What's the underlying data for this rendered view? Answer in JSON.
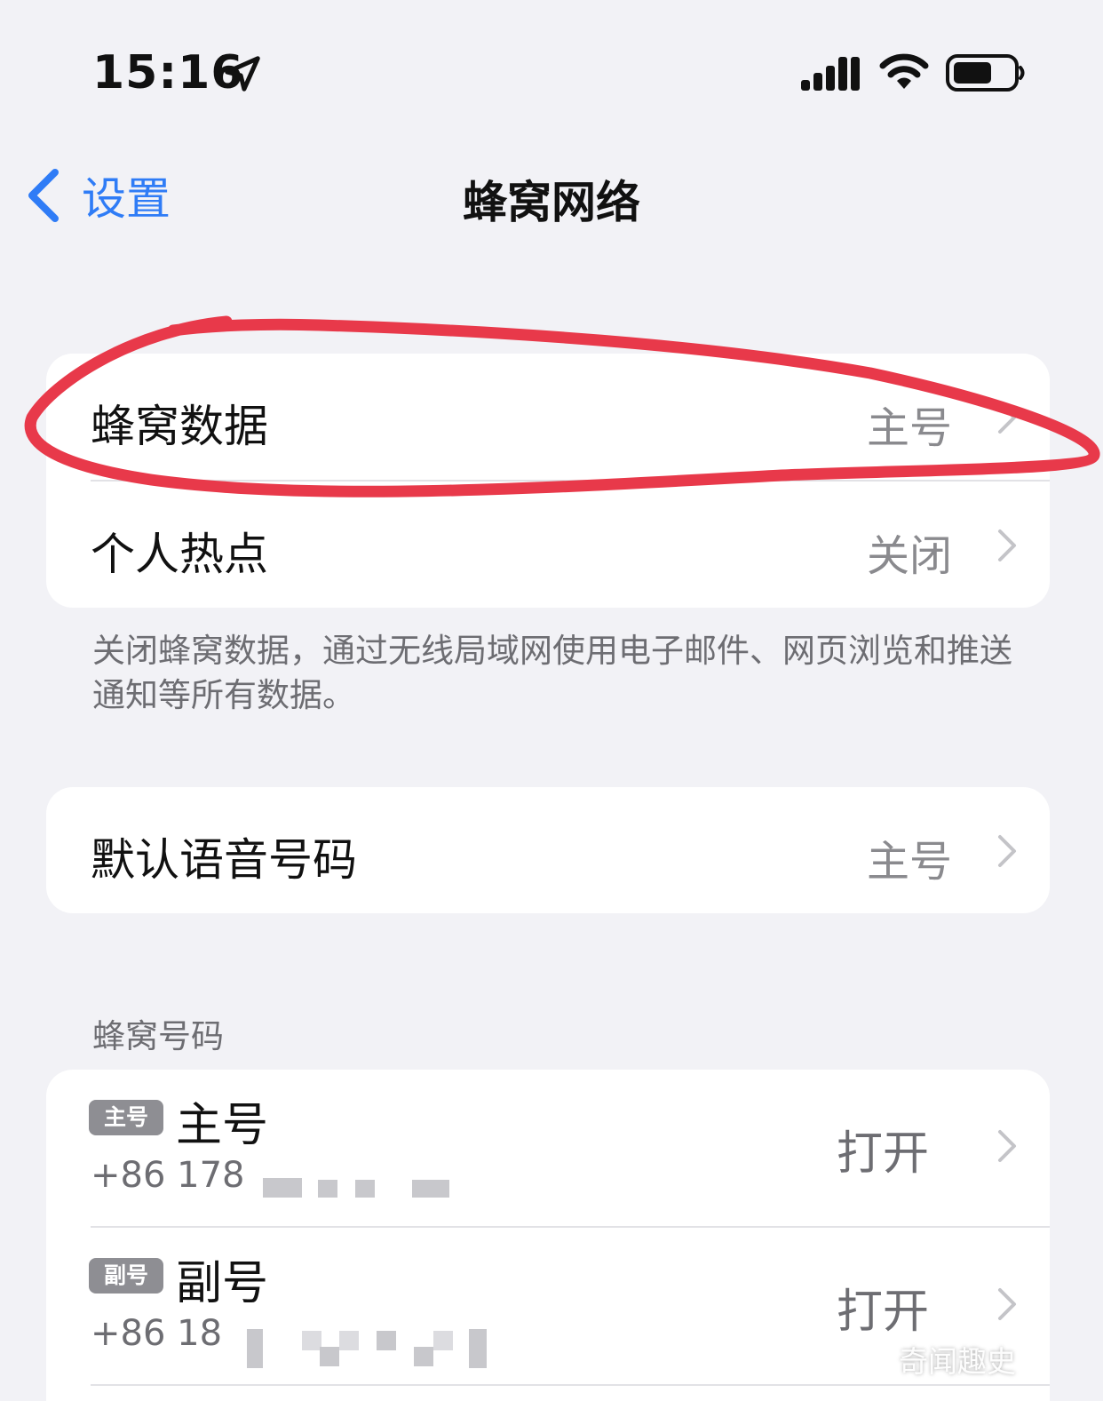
{
  "status_bar": {
    "time": "15:16",
    "icons": [
      "location-arrow-icon",
      "cellular-signal-icon",
      "wifi-icon",
      "battery-icon"
    ]
  },
  "nav": {
    "back_label": "设置",
    "title": "蜂窝网络"
  },
  "group1": {
    "rows": [
      {
        "label": "蜂窝数据",
        "value": "主号"
      },
      {
        "label": "个人热点",
        "value": "关闭"
      }
    ],
    "footer": "关闭蜂窝数据，通过无线局域网使用电子邮件、网页浏览和推送通知等所有数据。"
  },
  "group2": {
    "rows": [
      {
        "label": "默认语音号码",
        "value": "主号"
      }
    ]
  },
  "lines_section": {
    "header": "蜂窝号码",
    "lines": [
      {
        "badge": "主号",
        "name": "主号",
        "number": "+86 178",
        "status": "打开"
      },
      {
        "badge": "副号",
        "name": "副号",
        "number": "+86 18",
        "status": "打开"
      }
    ]
  },
  "watermark": "奇闻趣史",
  "colors": {
    "accent": "#2f7cf6",
    "annotation": "#e8394a",
    "background": "#f2f2f6",
    "secondary_text": "#6d6d72"
  }
}
